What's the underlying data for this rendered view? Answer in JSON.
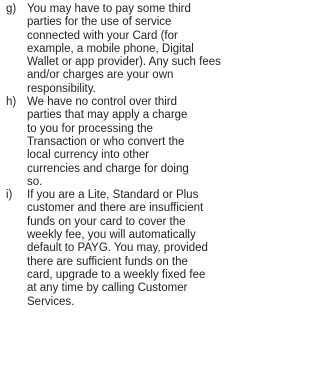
{
  "clauses": [
    {
      "marker": "g)",
      "text": "You may have to pay some third\nparties for the use of service\nconnected with your Card (for\nexample, a mobile phone, Digital\nWallet or app provider). Any such fees\nand/or charges are your own\nresponsibility."
    },
    {
      "marker": "h)",
      "text": "We have no control over third\nparties that may apply a charge\nto you for processing the\nTransaction or who convert the\nlocal currency into other\ncurrencies and charge for doing\nso."
    },
    {
      "marker": "i)",
      "text": "If you are a Lite, Standard or Plus\ncustomer and there are insufficient\nfunds on your card to cover the\nweekly fee, you will automatically\ndefault to PAYG. You may, provided\nthere are sufficient funds on the\ncard, upgrade to a weekly fixed fee\nat any time by calling Customer\nServices."
    }
  ]
}
